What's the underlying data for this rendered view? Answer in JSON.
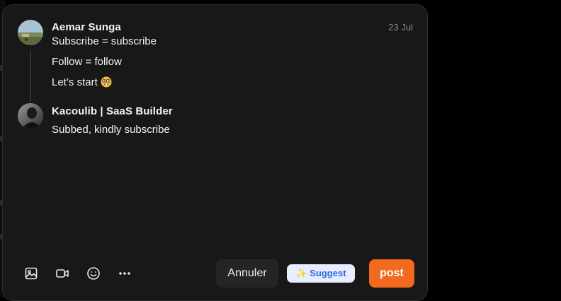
{
  "thread": {
    "date": "23 Jul",
    "original": {
      "author": "Aemar Sunga",
      "lines": [
        "Subscribe = subscribe",
        "Follow = follow",
        "Let’s start"
      ],
      "emoji": "nerd-face-emoji"
    },
    "reply": {
      "author": "Kacoulib | SaaS Builder",
      "text": "Subbed, kindly subscribe"
    }
  },
  "toolbar": {
    "icons": [
      "image-icon",
      "video-icon",
      "emoji-icon",
      "more-icon"
    ]
  },
  "actions": {
    "cancel_label": "Annuler",
    "suggest_label": "✨ Suggest",
    "post_label": "post"
  },
  "colors": {
    "post": "#f26a1f",
    "suggest_bg": "#e6eeff",
    "suggest_text": "#2f6bd8"
  }
}
